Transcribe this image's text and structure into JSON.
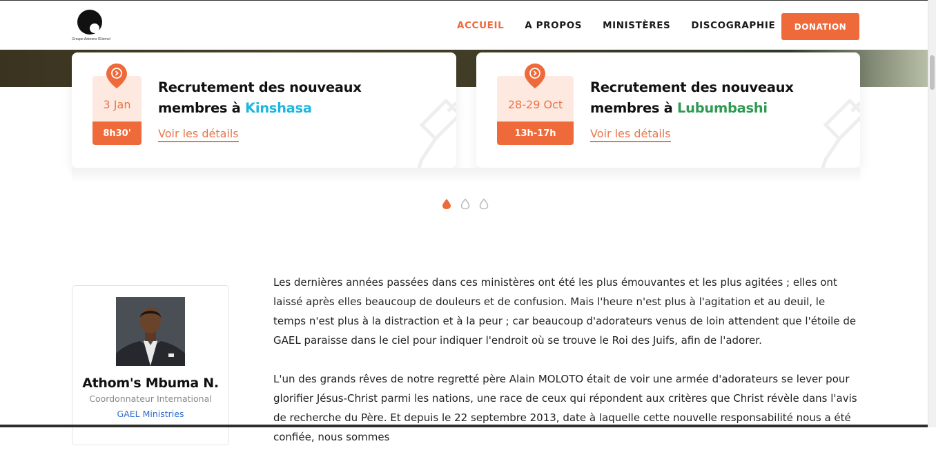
{
  "header": {
    "logo_text": "Groupe Adorons l'Eternel",
    "nav": [
      {
        "label": "ACCUEIL",
        "active": true
      },
      {
        "label": "A PROPOS",
        "active": false
      },
      {
        "label": "MINISTÈRES",
        "active": false
      },
      {
        "label": "DISCOGRAPHIE",
        "active": false
      }
    ],
    "donate_label": "DONATION"
  },
  "events": [
    {
      "date": "3 Jan",
      "time": "8h30'",
      "title_prefix": "Recrutement des nouveaux membres à ",
      "city": "Kinshasa",
      "link": "Voir les détails"
    },
    {
      "date": "28-29 Oct",
      "time": "13h-17h",
      "title_prefix": "Recrutement des nouveaux membres à ",
      "city": "Lubumbashi",
      "link": "Voir les détails"
    }
  ],
  "slider": {
    "count": 3,
    "active_index": 0
  },
  "profile": {
    "name": "Athom's Mbuma N.",
    "role": "Coordonnateur International",
    "org": "GAEL Ministries"
  },
  "content": {
    "paragraphs": [
      "Les dernières années passées dans ces ministères ont été les plus émouvantes et les plus agitées ; elles ont laissé après elles beaucoup de douleurs et de confusion. Mais l'heure n'est plus à l'agitation et au deuil, le temps n'est plus à la distraction et à la peur ; car beaucoup d'adorateurs venus de loin attendent que l'étoile de GAEL paraisse dans le ciel pour indiquer l'endroit où se trouve le Roi des Juifs, afin de l'adorer.",
      "L'un des grands rêves de notre regretté père Alain MOLOTO était de voir une armée d'adorateurs se lever pour glorifier Jésus-Christ parmi les nations, une race de ceux qui répondent aux critères que Christ révèle dans l'avis de recherche du Père. Et depuis le 22 septembre 2013, date à laquelle cette nouvelle responsabilité nous a été confiée, nous sommes"
    ]
  },
  "colors": {
    "accent": "#ef6a3a",
    "kinshasa": "#1fb6e0",
    "lubumbashi": "#2e9a52",
    "link_blue": "#2f6bd0"
  }
}
